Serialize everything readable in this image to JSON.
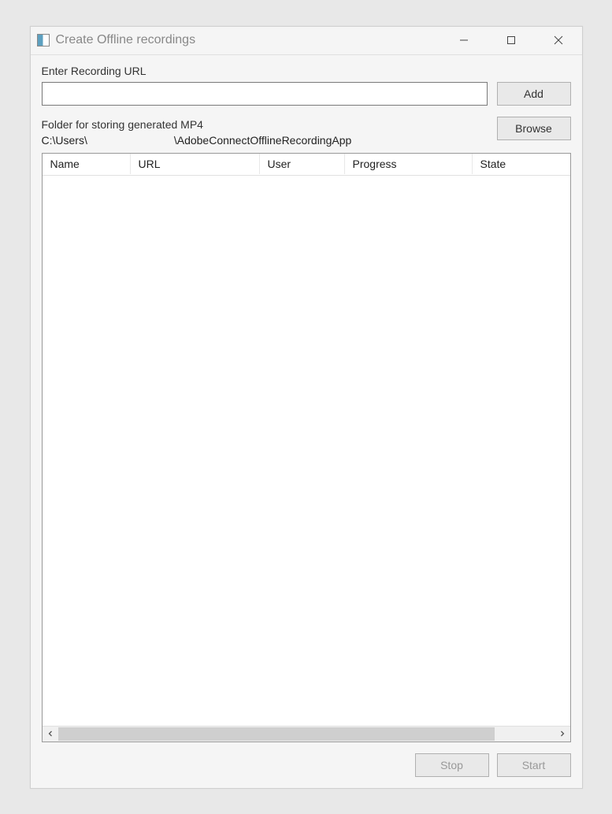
{
  "window": {
    "title": "Create Offline recordings"
  },
  "url_section": {
    "label": "Enter Recording URL",
    "value": "",
    "add_button": "Add"
  },
  "folder_section": {
    "label": "Folder for storing generated MP4",
    "path_prefix": "C:\\Users\\",
    "path_suffix": "\\AdobeConnectOfflineRecordingApp",
    "browse_button": "Browse"
  },
  "table": {
    "headers": {
      "name": "Name",
      "url": "URL",
      "user": "User",
      "progress": "Progress",
      "state": "State"
    },
    "rows": []
  },
  "footer": {
    "stop_button": "Stop",
    "start_button": "Start"
  }
}
